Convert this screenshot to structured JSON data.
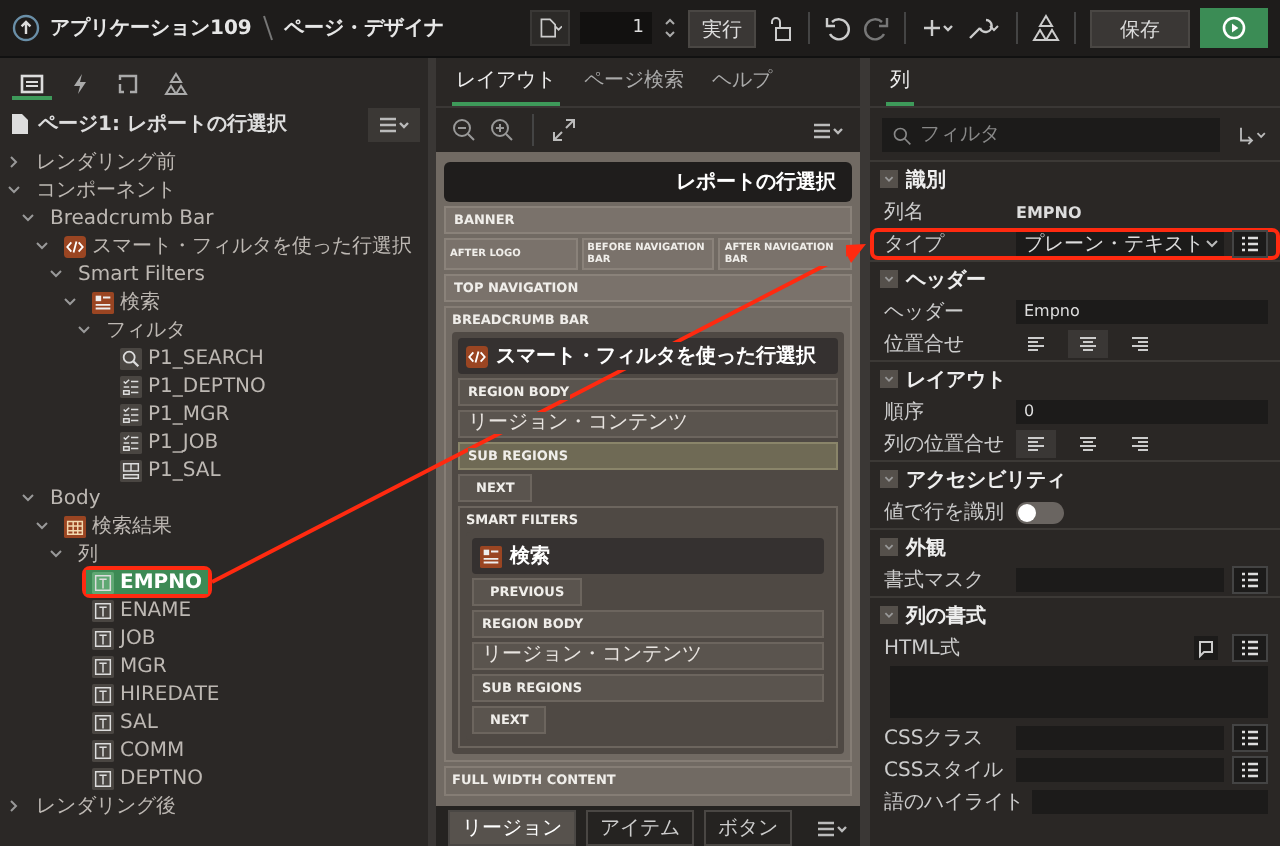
{
  "app_bar": {
    "app": "アプリケーション109",
    "page": "ページ・デザイナ"
  },
  "toolbar": {
    "page_number": "1",
    "run": "実行",
    "save": "保存"
  },
  "left": {
    "tabs": [
      {
        "kind": "rendering",
        "selected": true
      },
      {
        "kind": "dynamic",
        "selected": false
      },
      {
        "kind": "processing",
        "selected": false
      },
      {
        "kind": "shared",
        "selected": false
      }
    ],
    "page_title": "ページ1: レポートの行選択",
    "tree": [
      {
        "label": "レンダリング前",
        "expanded": false,
        "selected": false
      },
      {
        "label": "コンポーネント",
        "expanded": true,
        "selected": false,
        "children": [
          {
            "label": "Breadcrumb Bar",
            "expanded": true,
            "selected": false,
            "children": [
              {
                "label": "スマート・フィルタを使った行選択",
                "kind": "region",
                "expanded": true,
                "selected": false,
                "children": [
                  {
                    "label": "Smart Filters",
                    "expanded": true,
                    "selected": false,
                    "children": [
                      {
                        "label": "検索",
                        "kind": "filters",
                        "expanded": true,
                        "selected": false,
                        "children": [
                          {
                            "label": "フィルタ",
                            "expanded": true,
                            "selected": false,
                            "children": [
                              {
                                "label": "P1_SEARCH",
                                "kind": "search",
                                "selected": false
                              },
                              {
                                "label": "P1_DEPTNO",
                                "kind": "checklist",
                                "selected": false
                              },
                              {
                                "label": "P1_MGR",
                                "kind": "checklist",
                                "selected": false
                              },
                              {
                                "label": "P1_JOB",
                                "kind": "checklist",
                                "selected": false
                              },
                              {
                                "label": "P1_SAL",
                                "kind": "range",
                                "selected": false
                              }
                            ]
                          }
                        ]
                      }
                    ]
                  }
                ]
              }
            ]
          },
          {
            "label": "Body",
            "expanded": true,
            "selected": false,
            "children": [
              {
                "label": "検索結果",
                "kind": "report",
                "expanded": true,
                "selected": false,
                "children": [
                  {
                    "label": "列",
                    "expanded": true,
                    "selected": false,
                    "children": [
                      {
                        "label": "EMPNO",
                        "kind": "column",
                        "selected": true,
                        "callout": true
                      },
                      {
                        "label": "ENAME",
                        "kind": "column",
                        "selected": false
                      },
                      {
                        "label": "JOB",
                        "kind": "column",
                        "selected": false
                      },
                      {
                        "label": "MGR",
                        "kind": "column",
                        "selected": false
                      },
                      {
                        "label": "HIREDATE",
                        "kind": "column",
                        "selected": false
                      },
                      {
                        "label": "SAL",
                        "kind": "column",
                        "selected": false
                      },
                      {
                        "label": "COMM",
                        "kind": "column",
                        "selected": false
                      },
                      {
                        "label": "DEPTNO",
                        "kind": "column",
                        "selected": false
                      }
                    ]
                  }
                ]
              }
            ]
          }
        ]
      },
      {
        "label": "レンダリング後",
        "expanded": false,
        "selected": false
      }
    ]
  },
  "center": {
    "tabs": [
      {
        "label": "レイアウト",
        "selected": true
      },
      {
        "label": "ページ検索",
        "selected": false
      },
      {
        "label": "ヘルプ",
        "selected": false
      }
    ],
    "page_title": "レポートの行選択",
    "layout": [
      {
        "kind": "slot",
        "label": "BANNER"
      },
      {
        "kind": "row",
        "slots": [
          "AFTER LOGO",
          "BEFORE NAVIGATION BAR",
          "AFTER NAVIGATION BAR"
        ]
      },
      {
        "kind": "slot",
        "label": "TOP NAVIGATION"
      },
      {
        "kind": "position",
        "label": "BREADCRUMB BAR",
        "region": {
          "title": "スマート・フィルタを使った行選択",
          "kind": "static",
          "slots": [
            {
              "kind": "slot",
              "label": "REGION BODY",
              "selected": false
            },
            {
              "kind": "content",
              "label": "リージョン・コンテンツ",
              "selected": false
            },
            {
              "kind": "slot",
              "label": "SUB REGIONS",
              "selected": true
            },
            {
              "kind": "button",
              "label": "NEXT",
              "selected": false
            },
            {
              "kind": "position",
              "label": "SMART FILTERS",
              "region": {
                "title": "検索",
                "kind": "filters",
                "slots": [
                  {
                    "kind": "button",
                    "label": "PREVIOUS",
                    "selected": false
                  },
                  {
                    "kind": "slot",
                    "label": "REGION BODY",
                    "selected": false
                  },
                  {
                    "kind": "content",
                    "label": "リージョン・コンテンツ",
                    "selected": false
                  },
                  {
                    "kind": "slot",
                    "label": "SUB REGIONS",
                    "selected": false
                  },
                  {
                    "kind": "button",
                    "label": "NEXT",
                    "selected": false
                  }
                ]
              }
            }
          ]
        }
      },
      {
        "kind": "position",
        "label": "FULL WIDTH CONTENT"
      }
    ],
    "bottom_tabs": [
      {
        "label": "リージョン",
        "selected": true
      },
      {
        "label": "アイテム",
        "selected": false
      },
      {
        "label": "ボタン",
        "selected": false
      }
    ]
  },
  "right": {
    "tabs": [
      {
        "label": "列",
        "selected": true
      }
    ],
    "filter": {
      "placeholder": "フィルタ"
    },
    "sections": [
      {
        "title": "識別",
        "rows": [
          {
            "kind": "text",
            "label": "列名",
            "value": "EMPNO"
          },
          {
            "kind": "select",
            "label": "タイプ",
            "value": "プレーン・テキスト",
            "list_button": true,
            "callout": true
          }
        ]
      },
      {
        "title": "ヘッダー",
        "rows": [
          {
            "kind": "field",
            "label": "ヘッダー",
            "value": "Empno"
          },
          {
            "kind": "align",
            "label": "位置合せ",
            "options": [
              {
                "kind": "left",
                "selected": false
              },
              {
                "kind": "center",
                "selected": true
              },
              {
                "kind": "right",
                "selected": false
              }
            ]
          }
        ]
      },
      {
        "title": "レイアウト",
        "rows": [
          {
            "kind": "field",
            "label": "順序",
            "value": "0"
          },
          {
            "kind": "align",
            "label": "列の位置合せ",
            "options": [
              {
                "kind": "left",
                "selected": true
              },
              {
                "kind": "center",
                "selected": false
              },
              {
                "kind": "right",
                "selected": false
              }
            ]
          }
        ]
      },
      {
        "title": "アクセシビリティ",
        "rows": [
          {
            "kind": "switch",
            "label": "値で行を識別",
            "on": false
          }
        ]
      },
      {
        "title": "外観",
        "rows": [
          {
            "kind": "field",
            "label": "書式マスク",
            "list_button": true
          }
        ]
      },
      {
        "title": "列の書式",
        "rows": [
          {
            "kind": "textarea",
            "label": "HTML式",
            "list_button": true
          },
          {
            "kind": "field",
            "label": "CSSクラス",
            "list_button": true
          },
          {
            "kind": "field",
            "label": "CSSスタイル",
            "list_button": true
          },
          {
            "kind": "field",
            "label": "語のハイライト"
          }
        ]
      }
    ]
  }
}
